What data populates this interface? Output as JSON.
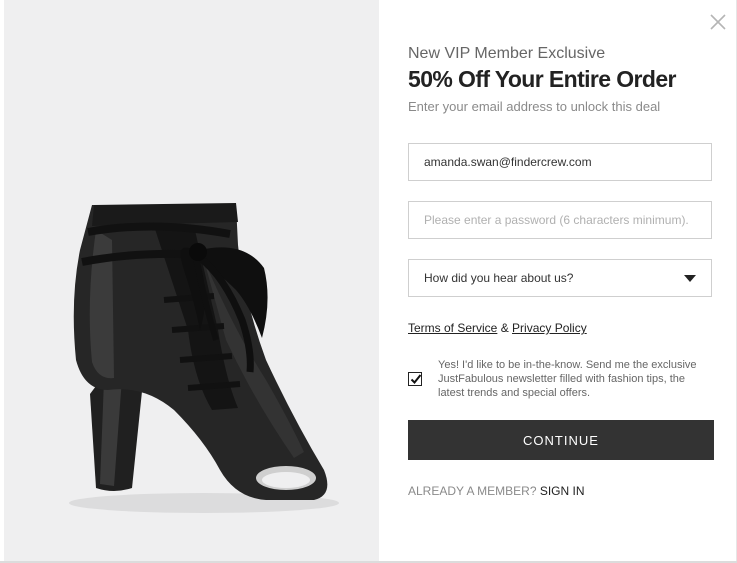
{
  "modal": {
    "eyebrow": "New VIP Member Exclusive",
    "title": "50% Off Your Entire Order",
    "subtitle": "Enter your email address to unlock this deal"
  },
  "form": {
    "email_value": "amanda.swan@findercrew.com",
    "password_placeholder": "Please enter a password (6 characters minimum).",
    "referral_selected": "How did you hear about us?",
    "terms_label": "Terms of Service",
    "ampersand": " & ",
    "privacy_label": "Privacy Policy",
    "optin_text": "Yes! I'd like to be in-the-know. Send me the exclusive JustFabulous newsletter filled with fashion tips, the latest trends and special offers.",
    "optin_checked": true,
    "continue_label": "CONTINUE"
  },
  "footer": {
    "member_prompt": "ALREADY A MEMBER? ",
    "signin_label": "SIGN IN"
  },
  "product_image": {
    "subject": "black lace-up peep-toe block-heel ankle boot",
    "background_color": "#efeff0"
  },
  "icons": {
    "close": "close-icon",
    "caret": "chevron-down-icon",
    "check": "checkmark-icon"
  },
  "colors": {
    "button": "#333333",
    "text_dark": "#222222",
    "text_muted": "#8a8a8a",
    "border": "#cfcfcf"
  }
}
